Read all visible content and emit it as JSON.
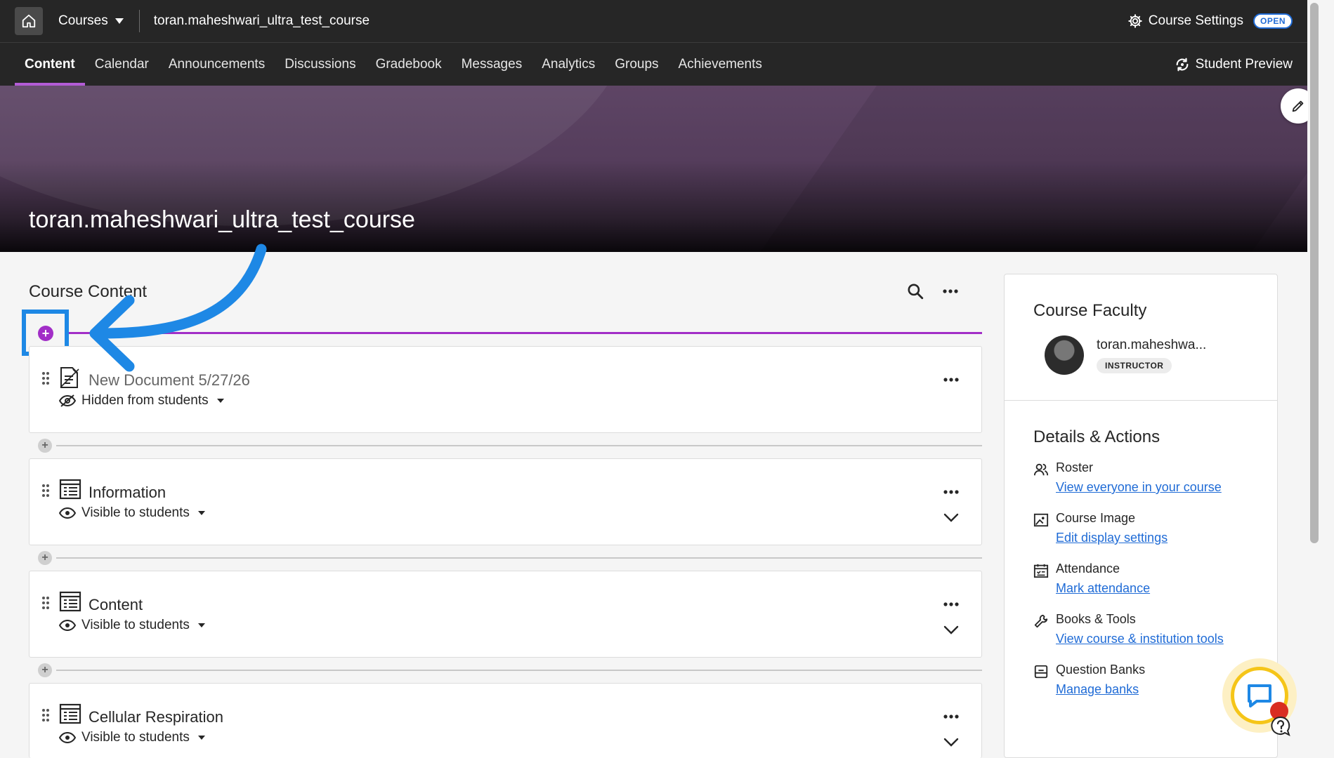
{
  "topbar": {
    "courses_label": "Courses",
    "course_name": "toran.maheshwari_ultra_test_course",
    "settings_label": "Course Settings",
    "open_badge": "OPEN"
  },
  "nav": {
    "tabs": [
      {
        "label": "Content",
        "active": true
      },
      {
        "label": "Calendar"
      },
      {
        "label": "Announcements"
      },
      {
        "label": "Discussions"
      },
      {
        "label": "Gradebook"
      },
      {
        "label": "Messages"
      },
      {
        "label": "Analytics"
      },
      {
        "label": "Groups"
      },
      {
        "label": "Achievements"
      }
    ],
    "student_preview": "Student Preview"
  },
  "banner": {
    "title": "toran.maheshwari_ultra_test_course"
  },
  "content": {
    "title": "Course Content",
    "items": [
      {
        "title": "New Document 5/27/26",
        "visibility": "Hidden from students",
        "icon": "document-icon",
        "hidden": true
      },
      {
        "title": "Information",
        "visibility": "Visible to students",
        "icon": "folder-icon"
      },
      {
        "title": "Content",
        "visibility": "Visible to students",
        "icon": "folder-icon"
      },
      {
        "title": "Cellular Respiration",
        "visibility": "Visible to students",
        "icon": "folder-icon"
      }
    ]
  },
  "sidebar": {
    "faculty_title": "Course Faculty",
    "faculty_name": "toran.maheshwa...",
    "faculty_role": "INSTRUCTOR",
    "details_title": "Details & Actions",
    "details": [
      {
        "label": "Roster",
        "link": "View everyone in your course",
        "icon": "roster-icon"
      },
      {
        "label": "Course Image",
        "link": "Edit display settings",
        "icon": "image-icon"
      },
      {
        "label": "Attendance",
        "link": "Mark attendance",
        "icon": "attendance-icon"
      },
      {
        "label": "Books & Tools",
        "link": "View course & institution tools",
        "icon": "wrench-icon"
      },
      {
        "label": "Question Banks",
        "link": "Manage banks",
        "icon": "question-bank-icon"
      }
    ]
  },
  "colors": {
    "accent_purple": "#a22ec7",
    "link_blue": "#1f6bd6",
    "annotation_blue": "#1e88e5"
  }
}
